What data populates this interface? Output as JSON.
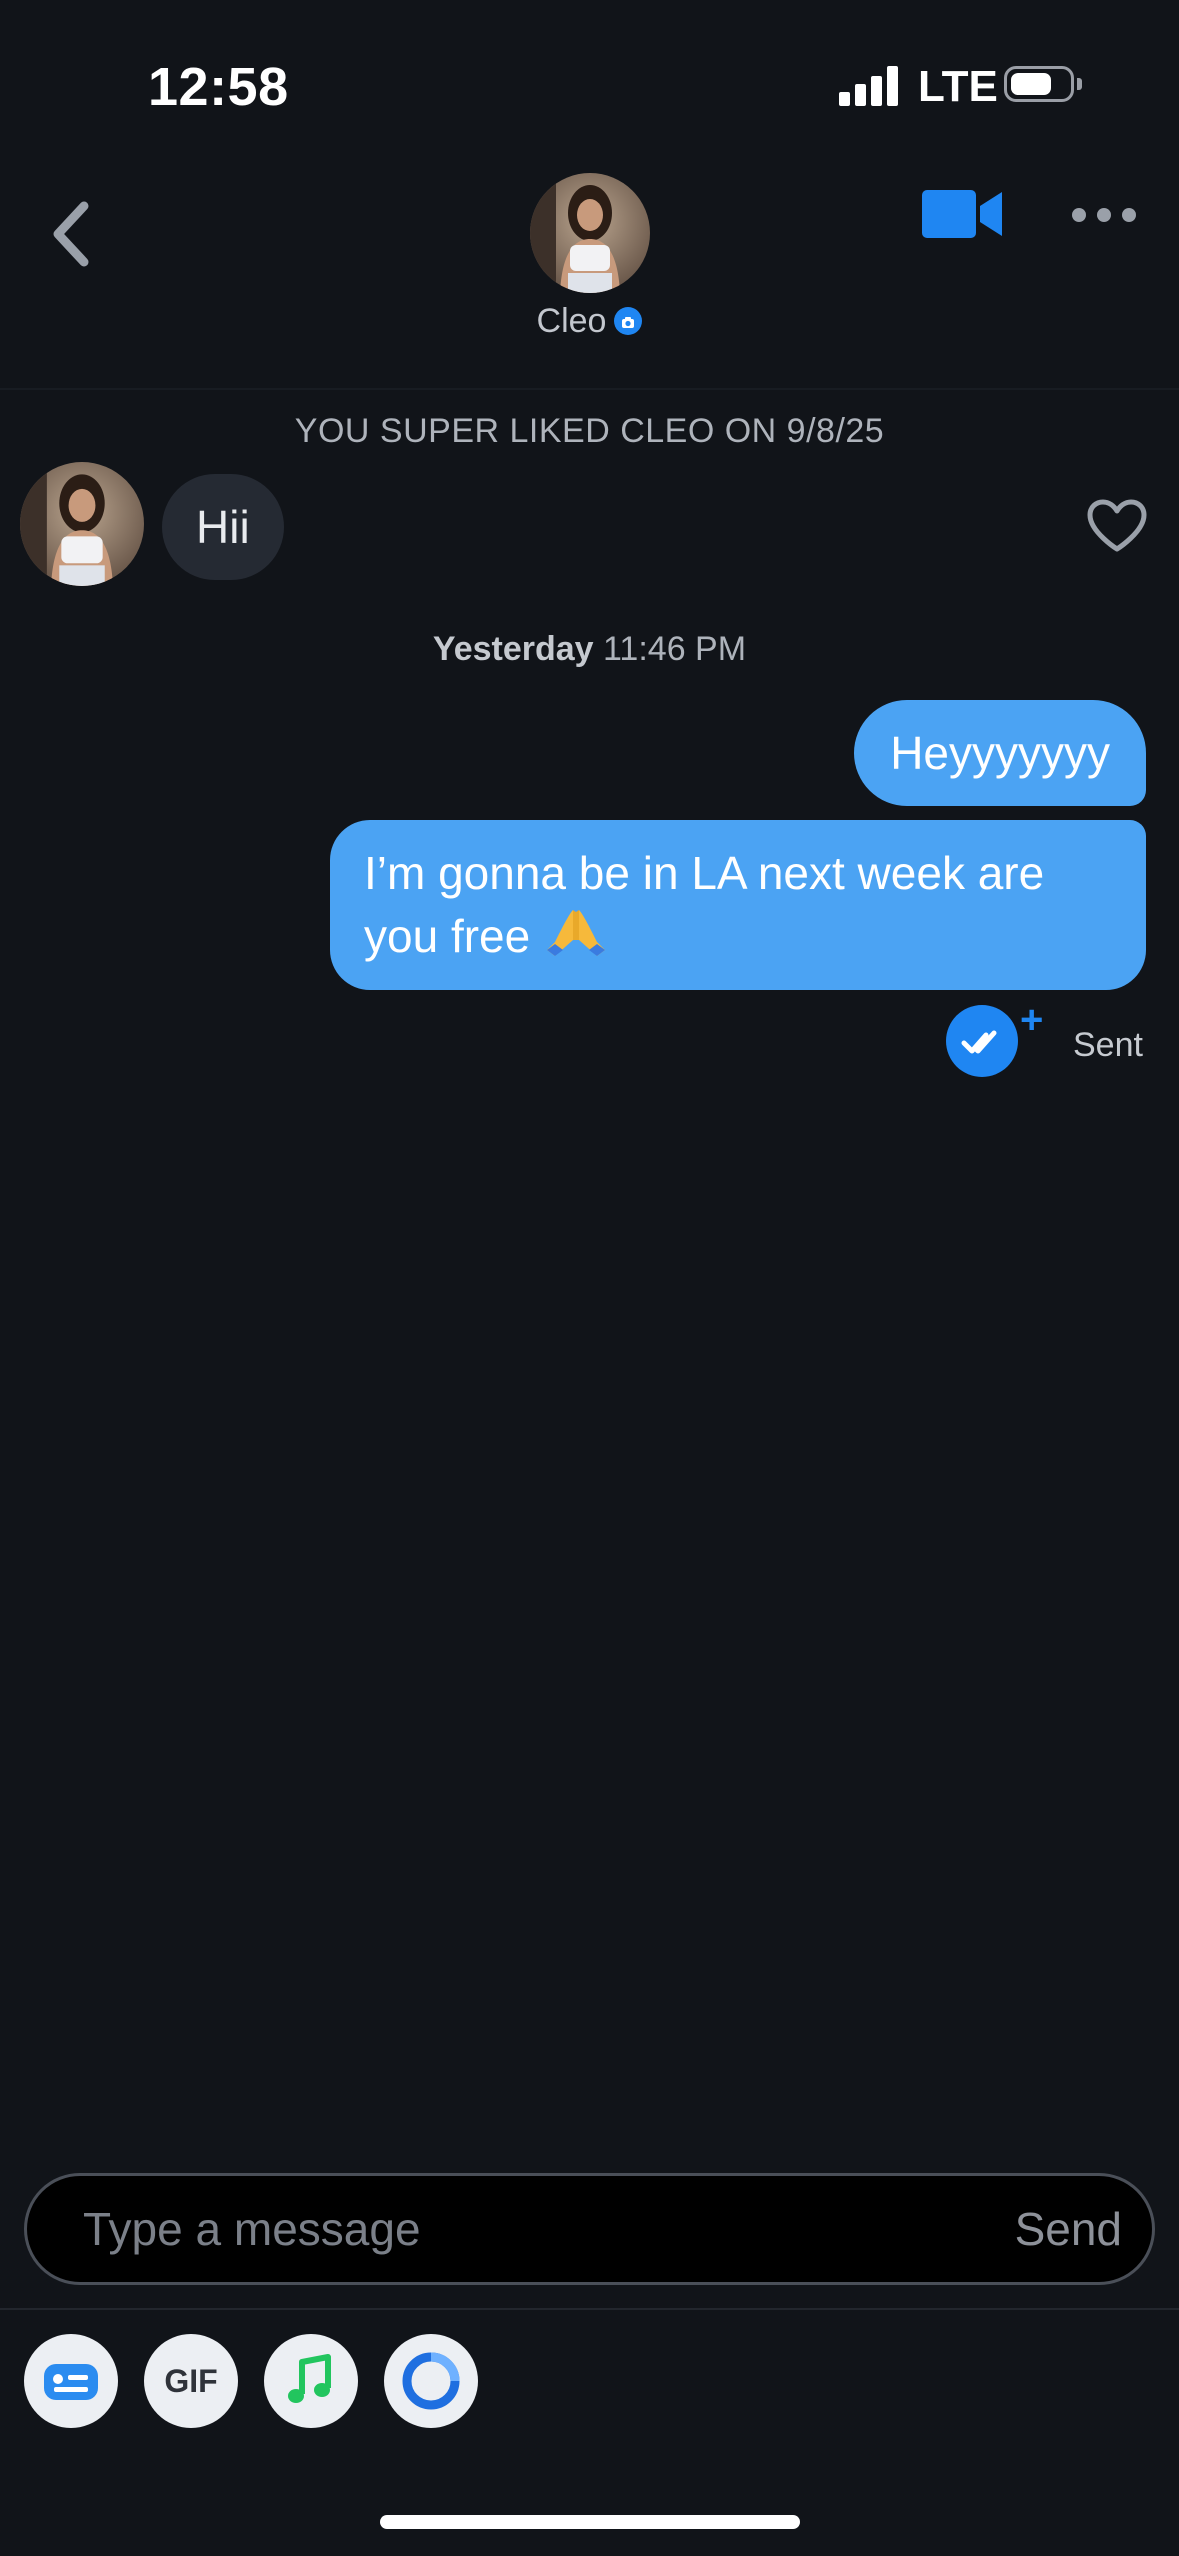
{
  "status_bar": {
    "time": "12:58",
    "network": "LTE"
  },
  "header": {
    "name": "Cleo",
    "back_icon": "chevron-left-icon",
    "video_icon": "video-camera-icon",
    "more_icon": "ellipsis-icon",
    "verified_icon": "camera-verified-icon"
  },
  "chat": {
    "super_like_note": "YOU SUPER LIKED CLEO ON 9/8/25",
    "incoming": {
      "text": "Hii"
    },
    "timestamp": {
      "day": "Yesterday",
      "time": "11:46 PM"
    },
    "outgoing": [
      {
        "text": "Heyyyyyyy"
      },
      {
        "text": "I’m gonna be in LA next week are you free",
        "emoji": "🙏"
      }
    ],
    "status": "Sent"
  },
  "composer": {
    "placeholder": "Type a message",
    "send_label": "Send"
  },
  "toolbar": {
    "gif_label": "GIF",
    "buttons": [
      "sticker-card-icon",
      "gif-icon",
      "music-note-icon",
      "circle-loader-icon"
    ]
  },
  "colors": {
    "background": "#111419",
    "accent": "#1f86f2",
    "outgoing_bubble": "#4ba3f3",
    "incoming_bubble": "#252a33",
    "music_green": "#22c55e"
  }
}
